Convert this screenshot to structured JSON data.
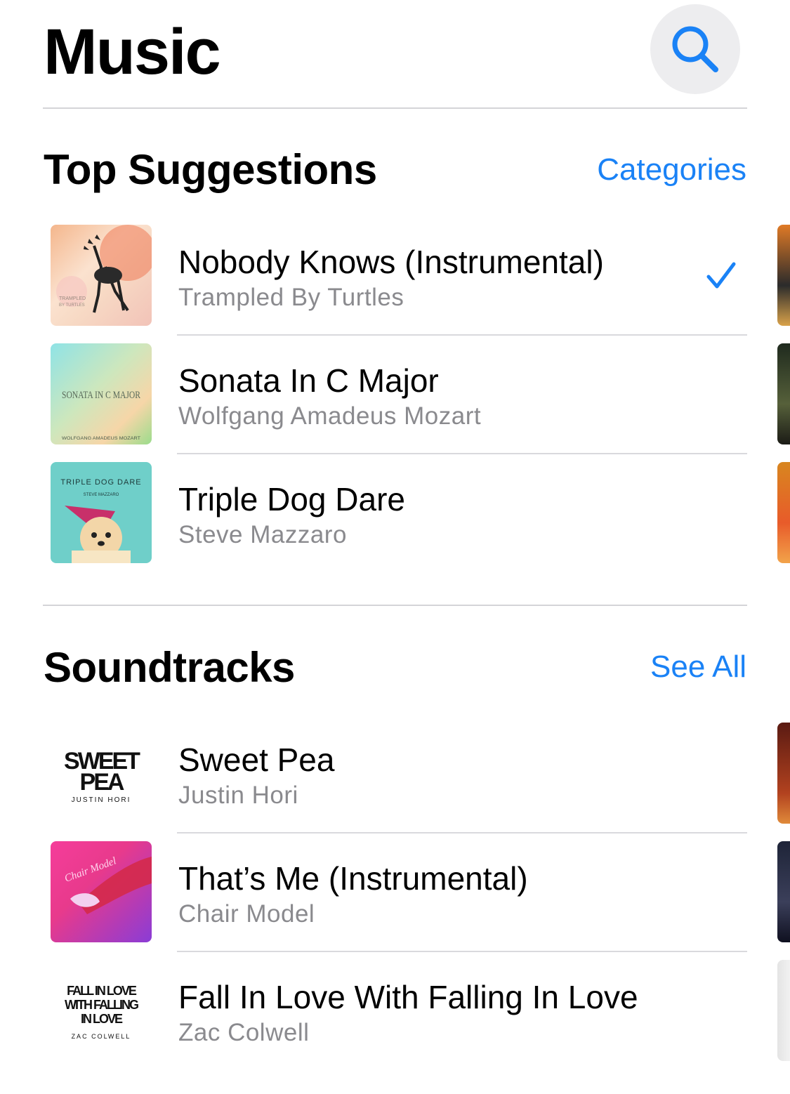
{
  "header": {
    "title": "Music",
    "search_icon": "search-icon"
  },
  "sections": [
    {
      "title": "Top Suggestions",
      "link": "Categories",
      "items": [
        {
          "song": "Nobody Knows (Instrumental)",
          "artist": "Trampled By Turtles",
          "selected": true,
          "art_text": [
            "TRAMPLED",
            "BY TURTLES"
          ]
        },
        {
          "song": "Sonata In C Major",
          "artist": "Wolfgang Amadeus Mozart",
          "selected": false,
          "art_text": [
            "SONATA IN C MAJOR",
            "WOLFGANG AMADEUS MOZART"
          ]
        },
        {
          "song": "Triple Dog Dare",
          "artist": "Steve Mazzaro",
          "selected": false,
          "art_text": [
            "TRIPLE DOG DARE",
            "STEVE MAZZARO"
          ]
        }
      ]
    },
    {
      "title": "Soundtracks",
      "link": "See All",
      "items": [
        {
          "song": "Sweet Pea",
          "artist": "Justin Hori",
          "selected": false,
          "art_text": [
            "SWEET",
            "PEA",
            "JUSTIN HORI"
          ]
        },
        {
          "song": "That’s Me (Instrumental)",
          "artist": "Chair Model",
          "selected": false,
          "art_text": [
            "Chair Model"
          ]
        },
        {
          "song": "Fall In Love With Falling In Love",
          "artist": "Zac Colwell",
          "selected": false,
          "art_text": [
            "FALL IN LOVE",
            "WITH FALLING",
            "IN LOVE",
            "ZAC COLWELL"
          ]
        }
      ]
    }
  ],
  "colors": {
    "accent": "#1a82f6",
    "secondary_text": "#8a8a8e",
    "search_bg": "#ededef"
  }
}
